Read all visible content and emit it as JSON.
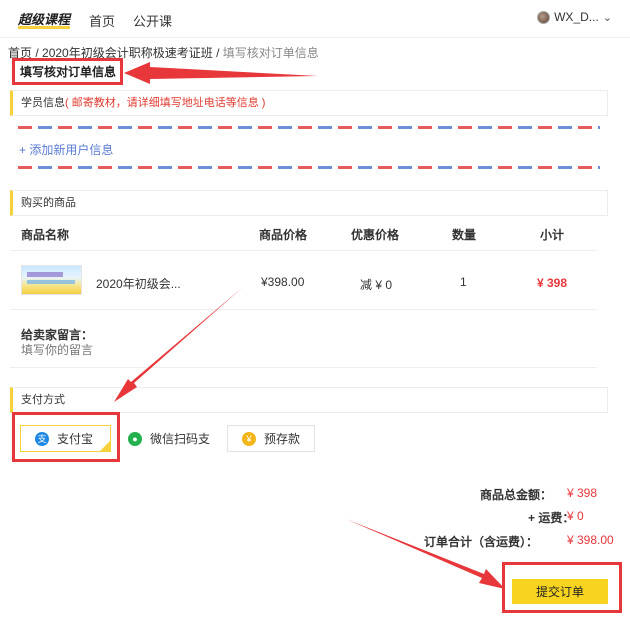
{
  "nav": {
    "logo_text": "超级课程",
    "links": [
      "首页",
      "公开课"
    ],
    "user_name": "WX_D...",
    "user_caret": "⌄"
  },
  "breadcrumb": {
    "home": "首页",
    "sep1": " / ",
    "course": "2020年初级会计职称极速考证班",
    "sep2": " / ",
    "current": "填写核对订单信息"
  },
  "page_title": "填写核对订单信息",
  "student": {
    "header": "学员信息",
    "hint": "( 邮寄教材，请详细填写地址电话等信息 )",
    "add_user": "+ 添加新用户信息"
  },
  "products": {
    "header": "购买的商品",
    "columns": [
      "商品名称",
      "商品价格",
      "优惠价格",
      "数量",
      "小计"
    ],
    "rows": [
      {
        "name": "2020年初级会...",
        "price": "¥398.00",
        "discount": "减 ¥ 0",
        "qty": "1",
        "subtotal": "¥ 398"
      }
    ]
  },
  "remark": {
    "label": "给卖家留言：",
    "placeholder": "填写你的留言"
  },
  "payment": {
    "header": "支付方式",
    "options": [
      {
        "label": "支付宝",
        "icon": "alipay-icon",
        "selected": true
      },
      {
        "label": "微信扫码支",
        "icon": "wechat-icon",
        "selected": false
      },
      {
        "label": "预存款",
        "icon": "yen-coin-icon",
        "selected": false
      }
    ]
  },
  "totals": {
    "goods_label": "商品总金额：",
    "goods_value": "¥ 398",
    "shipping_label": "+ 运费：",
    "shipping_value": "¥ 0",
    "total_label": "订单合计（含运费）：",
    "total_value": "¥ 398.00"
  },
  "submit_label": "提交订单",
  "colors": {
    "accent_yellow": "#f5d23b",
    "price_red": "#e8373a",
    "link_blue": "#5b7bd5",
    "annotation_red": "#e8373a"
  }
}
